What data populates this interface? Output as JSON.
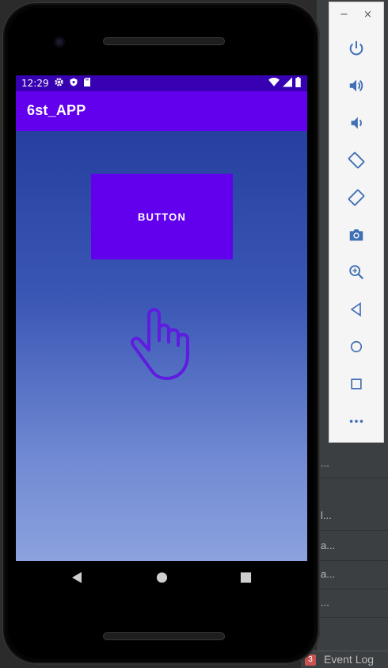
{
  "status_bar": {
    "time": "12:29",
    "left_icons": [
      "settings-icon",
      "shield-icon",
      "sd-card-icon"
    ],
    "right_icons": [
      "wifi-icon",
      "signal-icon",
      "battery-icon"
    ]
  },
  "app_bar": {
    "title": "6st_APP"
  },
  "main": {
    "button_label": "BUTTON",
    "pointer_icon": "hand-pointer-icon"
  },
  "nav_bar": {
    "buttons": [
      "back-icon",
      "home-icon",
      "recents-icon"
    ]
  },
  "emulator_toolbar": {
    "window_controls": [
      "−",
      "×"
    ],
    "buttons": [
      "power",
      "volume-up",
      "volume-down",
      "rotate-left",
      "rotate-right",
      "screenshot",
      "zoom",
      "back",
      "home",
      "overview",
      "more"
    ]
  },
  "ide": {
    "rows": [
      "...",
      "l...",
      "a...",
      "a...",
      "..."
    ],
    "event_log_count": "3",
    "event_log_label": "Event Log"
  },
  "colors": {
    "primary": "#6200ee",
    "primary_dark": "#3700b3",
    "gradient_top": "#263fa0",
    "gradient_bottom": "#8ca2de"
  }
}
